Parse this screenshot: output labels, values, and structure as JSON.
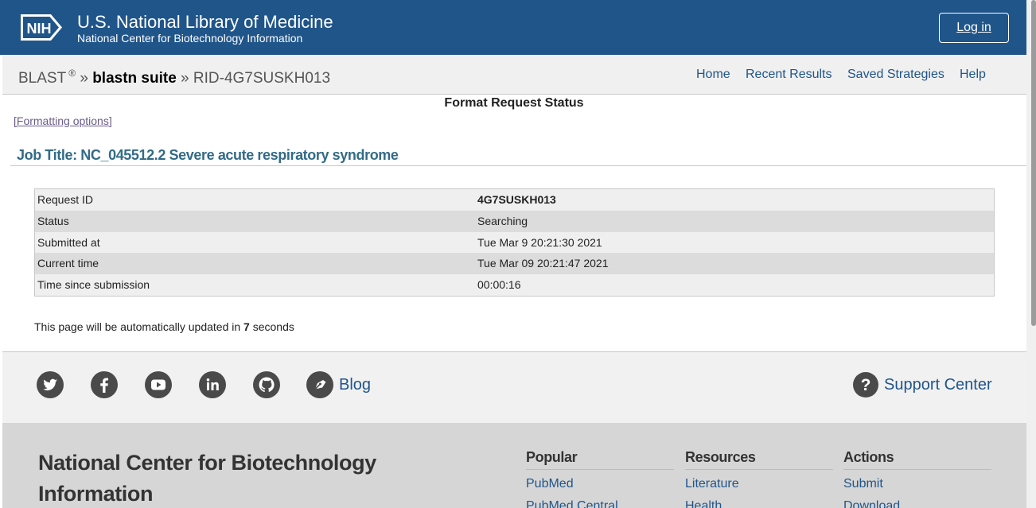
{
  "nih_header": {
    "logo_text": "NIH",
    "title": "U.S. National Library of Medicine",
    "subtitle": "National Center for Biotechnology Information",
    "login_label": "Log in"
  },
  "blast_bar": {
    "blast_label": "BLAST",
    "registered": "®",
    "sep": "»",
    "suite": "blastn suite",
    "rid": "RID-4G7SUSKH013",
    "nav": [
      "Home",
      "Recent Results",
      "Saved Strategies",
      "Help"
    ]
  },
  "main": {
    "status_heading": "Format Request Status",
    "formatting_options": "[Formatting options]",
    "job_title": "Job Title: NC_045512.2 Severe acute respiratory syndrome",
    "table": [
      {
        "label": "Request ID",
        "value": "4G7SUSKH013"
      },
      {
        "label": "Status",
        "value": "Searching"
      },
      {
        "label": "Submitted at",
        "value": "Tue Mar 9 20:21:30 2021"
      },
      {
        "label": "Current time",
        "value": "Tue Mar 09 20:21:47 2021"
      },
      {
        "label": "Time since submission",
        "value": "00:00:16"
      }
    ],
    "auto_update_prefix": "This page will be automatically updated in",
    "auto_update_seconds": "7",
    "auto_update_suffix": "seconds"
  },
  "footer": {
    "social_icons": [
      "twitter-icon",
      "facebook-icon",
      "youtube-icon",
      "linkedin-icon",
      "github-icon",
      "blog-icon"
    ],
    "blog_label": "Blog",
    "support_label": "Support Center",
    "ncbi_name": "National Center for Biotechnology Information",
    "columns": [
      {
        "heading": "Popular",
        "links": [
          "PubMed",
          "PubMed Central"
        ]
      },
      {
        "heading": "Resources",
        "links": [
          "Literature",
          "Health"
        ]
      },
      {
        "heading": "Actions",
        "links": [
          "Submit",
          "Download"
        ]
      }
    ]
  },
  "colors": {
    "nih_blue": "#20558a",
    "job_title": "#326b86",
    "icon_grey": "#4a4a4a"
  }
}
